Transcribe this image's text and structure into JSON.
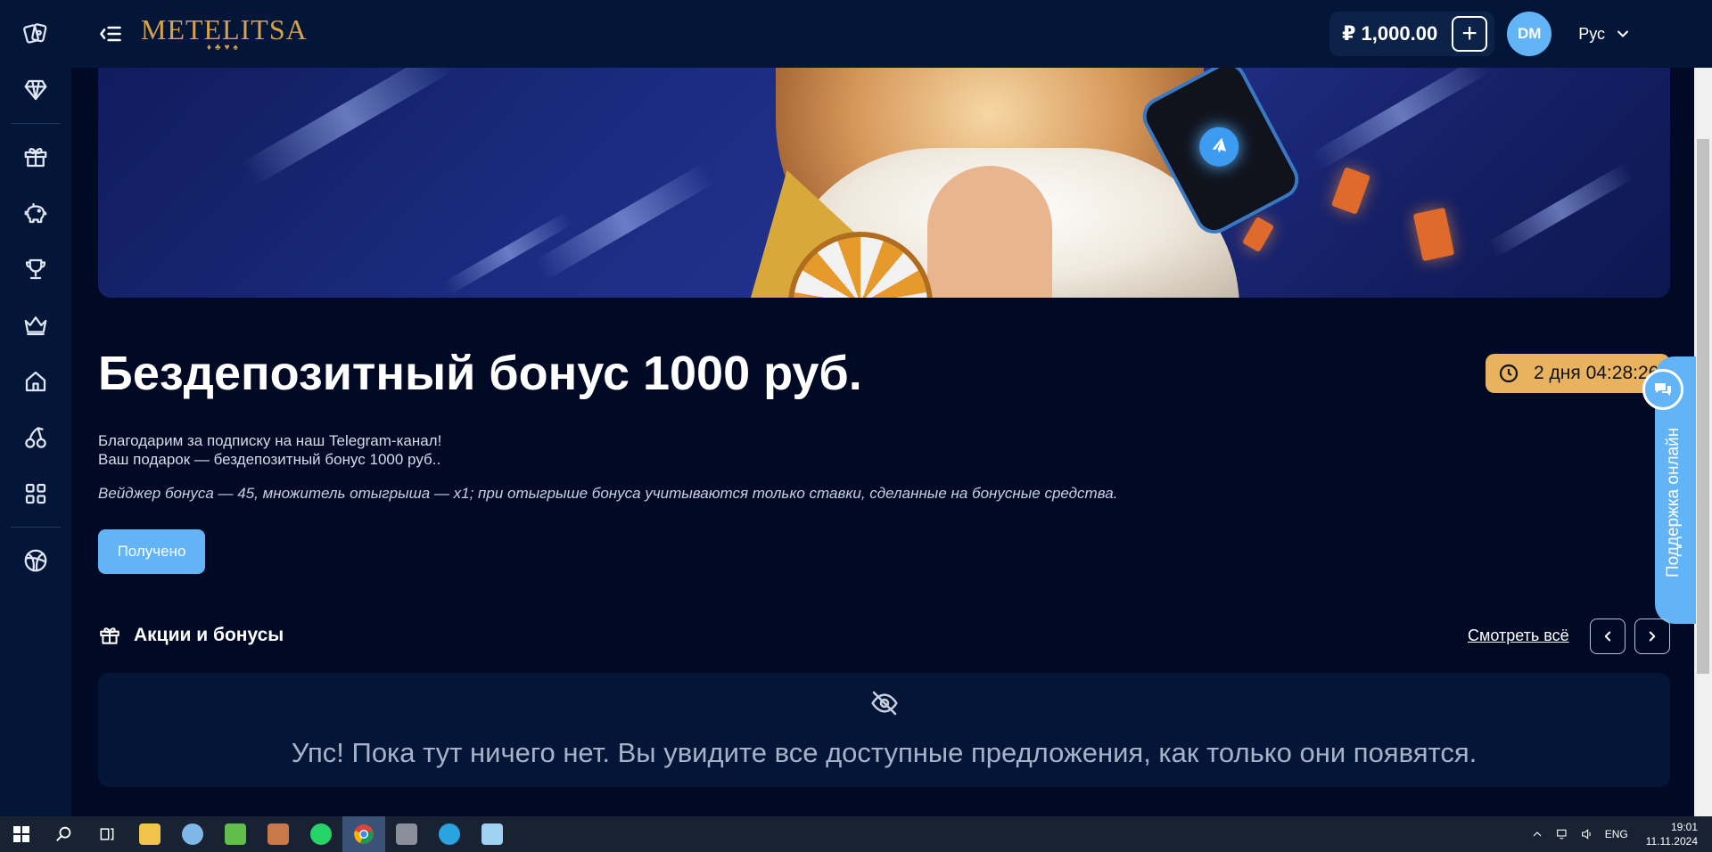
{
  "header": {
    "logo_text": "METELITSA",
    "logo_suits": "♦♣♥♠",
    "balance": "₽ 1,000.00",
    "plus_label": "+",
    "avatar_initials": "DM",
    "language": "Рус"
  },
  "sidebar": {
    "icons": [
      "cards-icon",
      "diamond-icon",
      "gift-icon",
      "piggy-bank-icon",
      "trophy-icon",
      "crown-icon",
      "home-icon",
      "cherry-icon",
      "grid-icon",
      "sports-ball-icon"
    ]
  },
  "bonus": {
    "title": "Бездепозитный бонус 1000 руб.",
    "timer": "2 дня 04:28:26",
    "line1": "Благодарим за подписку на наш Telegram-канал!",
    "line2": "Ваш подарок — бездепозитный бонус 1000 руб..",
    "note": "Вейджер бонуса — 45, множитель отыгрыша — x1; при отыгрыше бонуса учитываются только ставки, сделанные на бонусные средства.",
    "button_label": "Получено"
  },
  "support": {
    "label": "Поддержка онлайн"
  },
  "promotions": {
    "title": "Акции и бонусы",
    "see_all": "Смотреть всё",
    "empty_text": "Упс! Пока тут ничего нет. Вы увидите все доступные предложения, как только они появятся."
  },
  "taskbar": {
    "language": "ENG",
    "time": "19:01",
    "date": "11.11.2024",
    "apps": [
      "start-icon",
      "search-icon",
      "task-view-icon",
      "file-explorer-icon",
      "paint-icon",
      "notepad-icon",
      "photo-app-icon",
      "whatsapp-icon",
      "chrome-icon",
      "game-app-icon",
      "telegram-icon",
      "notes-icon"
    ]
  },
  "colors": {
    "background": "#000a24",
    "panel": "#031637",
    "accent_blue": "#63b3f7",
    "timer_gold": "#e9b25e",
    "logo_gold": "#d6a24c"
  }
}
